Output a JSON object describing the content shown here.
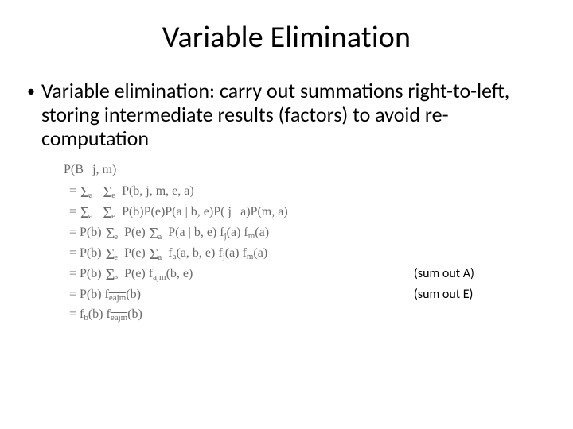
{
  "title": "Variable Elimination",
  "bullet": "Variable elimination: carry out summations right-to-left, storing intermediate results (factors) to avoid re-computation",
  "math": {
    "header": "P(B | j, m)",
    "eq": "=",
    "line1_a": "Σ",
    "line1_as": "a",
    "line1_b": "Σ",
    "line1_bs": "e",
    "line1_t": "P(b, j, m, e, a)",
    "line2_t": "P(b)P(e)P(a | b, e)P( j | a)P(m, a)",
    "line3_pre": "P(b)",
    "line3_mid": "P(e)",
    "line3_tail": "P(a | b, e) f",
    "line3_fj": "j",
    "line3_tail2": "(a) f",
    "line3_fm": "m",
    "line3_tail3": "(a)",
    "line4_tail": "f",
    "line4_fa": "a",
    "line4_tail2": "(a, b, e) f",
    "line4_tail3": "(a) f",
    "line4_tail4": "(a)",
    "line5_f": "f",
    "line5_sub": "ajm",
    "line5_arg": "(b, e)",
    "line6_pre": "P(b) f",
    "line6_sub": "eajm",
    "line6_arg": "(b)",
    "line7_pre": "f",
    "line7_sub1": "b",
    "line7_mid": "(b) f",
    "line7_sub2": "eajm",
    "line7_arg": "(b)"
  },
  "notes": {
    "a": "(sum out A)",
    "e": "(sum out E)"
  }
}
